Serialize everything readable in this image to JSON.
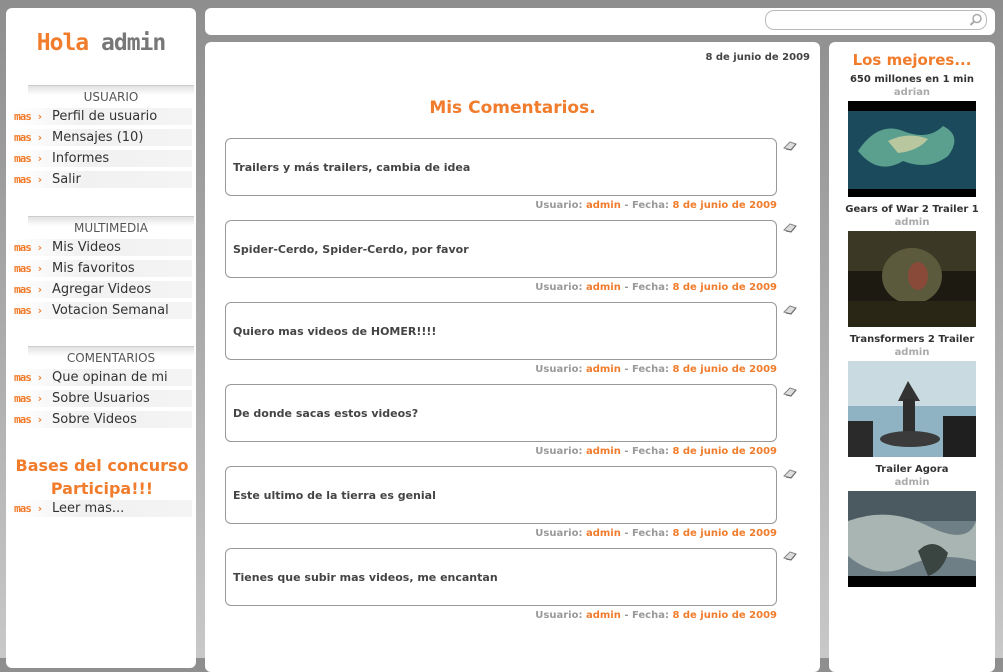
{
  "greeting": {
    "hola": "Hola",
    "user": "admin"
  },
  "sections": {
    "usuario": {
      "title": "USUARIO",
      "items": [
        "Perfil de usuario",
        "Mensajes (10)",
        "Informes",
        "Salir"
      ]
    },
    "multimedia": {
      "title": "MULTIMEDIA",
      "items": [
        "Mis Videos",
        "Mis favoritos",
        "Agregar Videos",
        "Votacion Semanal"
      ]
    },
    "comentarios": {
      "title": "COMENTARIOS",
      "items": [
        "Que opinan de mi",
        "Sobre Usuarios",
        "Sobre Videos"
      ]
    }
  },
  "more_tag": "mas",
  "bases": {
    "line1": "Bases del concurso",
    "line2": "Participa!!!",
    "link": "Leer mas..."
  },
  "search": {
    "value": "",
    "icon": "search-icon"
  },
  "main": {
    "date": "8 de junio de 2009",
    "title": "Mis Comentarios.",
    "meta_user_label": "Usuario:",
    "meta_date_label": "- Fecha:",
    "comments": [
      {
        "text": "Trailers y más trailers, cambia de idea",
        "user": "admin",
        "date": "8 de junio de 2009"
      },
      {
        "text": "Spider-Cerdo, Spider-Cerdo, por favor",
        "user": "admin",
        "date": "8 de junio de 2009"
      },
      {
        "text": "Quiero mas videos de HOMER!!!!",
        "user": "admin",
        "date": "8 de junio de 2009"
      },
      {
        "text": "De donde sacas estos videos?",
        "user": "admin",
        "date": "8 de junio de 2009"
      },
      {
        "text": "Este ultimo de la tierra es genial",
        "user": "admin",
        "date": "8 de junio de 2009"
      },
      {
        "text": "Tienes que subir mas videos, me encantan",
        "user": "admin",
        "date": "8 de junio de 2009"
      }
    ]
  },
  "right": {
    "title": "Los mejores...",
    "videos": [
      {
        "name": "650 millones en 1 min",
        "user": "adrian"
      },
      {
        "name": "Gears of War 2 Trailer 1",
        "user": "admin"
      },
      {
        "name": "Transformers 2 Trailer",
        "user": "admin"
      },
      {
        "name": "Trailer Agora",
        "user": "admin"
      }
    ]
  },
  "colors": {
    "accent": "#f07c2c",
    "text": "#333333",
    "muted": "#999999"
  }
}
